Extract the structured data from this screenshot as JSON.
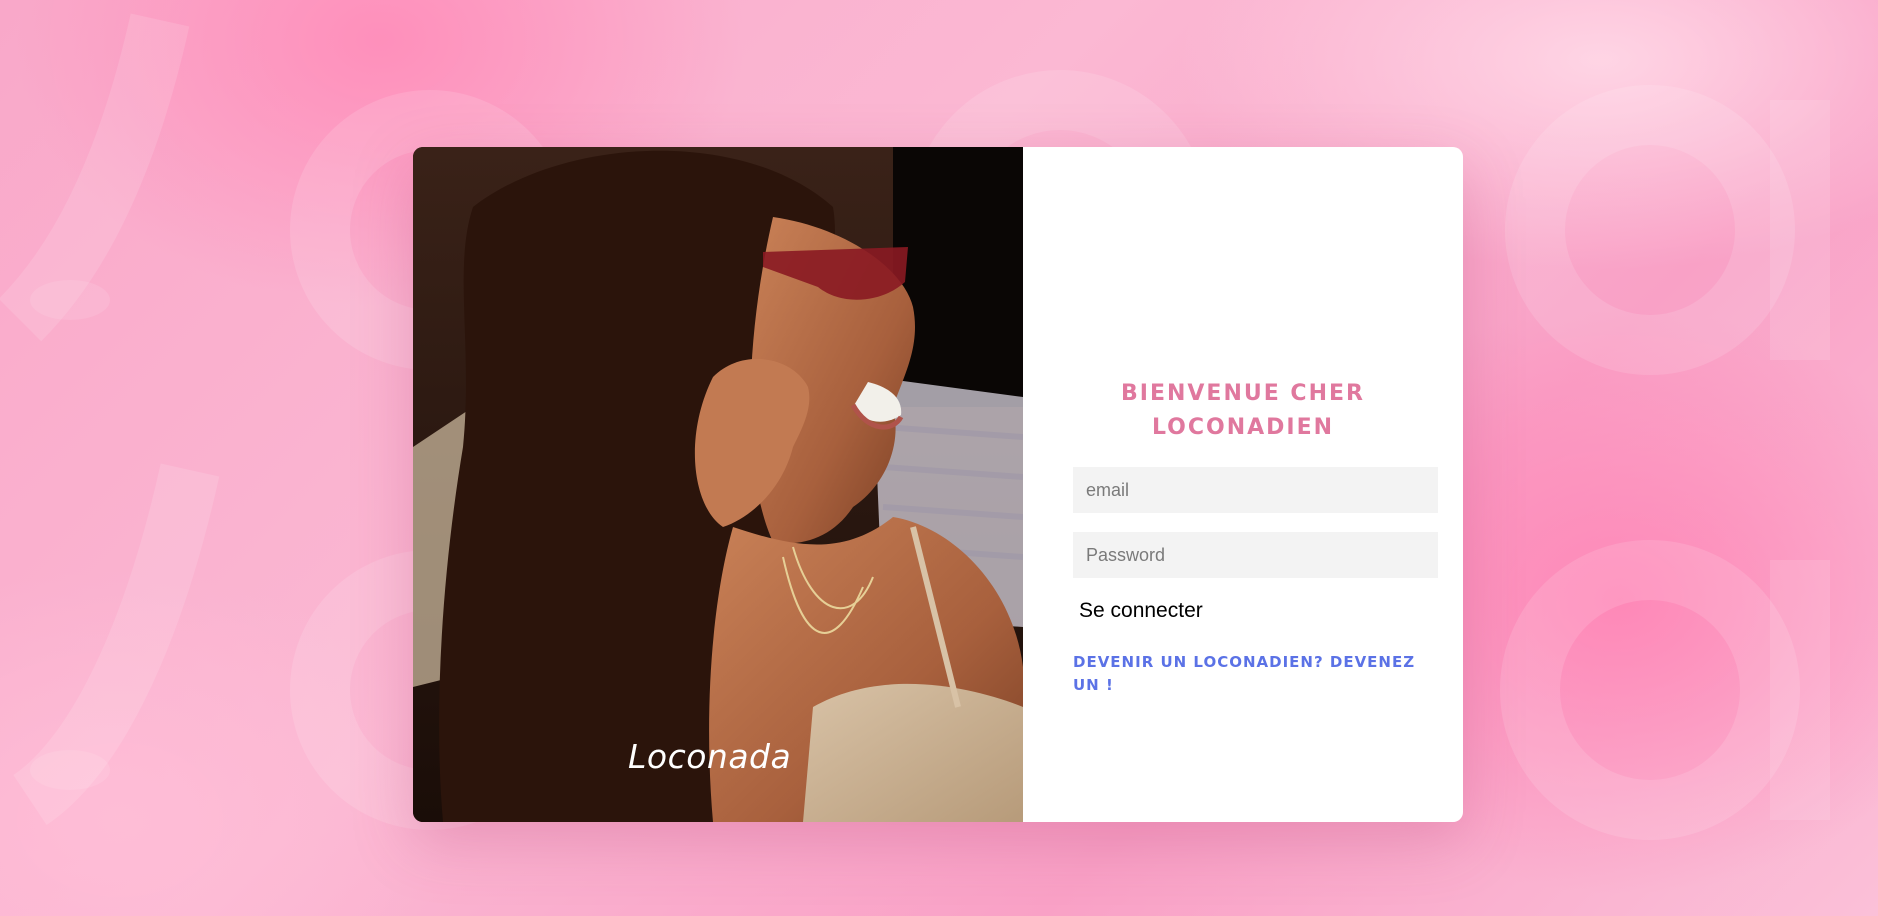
{
  "login": {
    "title": "BIENVENUE CHER LOCONADIEN",
    "email_placeholder": "email",
    "password_placeholder": "Password",
    "submit_label": "Se connecter",
    "register_link": "DEVENIR UN LOCONADIEN? DEVENEZ UN !"
  },
  "brand": {
    "logo_text": "Loconada"
  },
  "colors": {
    "title": "#e0789e",
    "link": "#5b72e6",
    "background": "#f9a8c9",
    "input_bg": "#f3f3f3"
  },
  "icons": {
    "brand_logo": "loconada-logo",
    "hero_image": "smiling-woman-photo"
  }
}
